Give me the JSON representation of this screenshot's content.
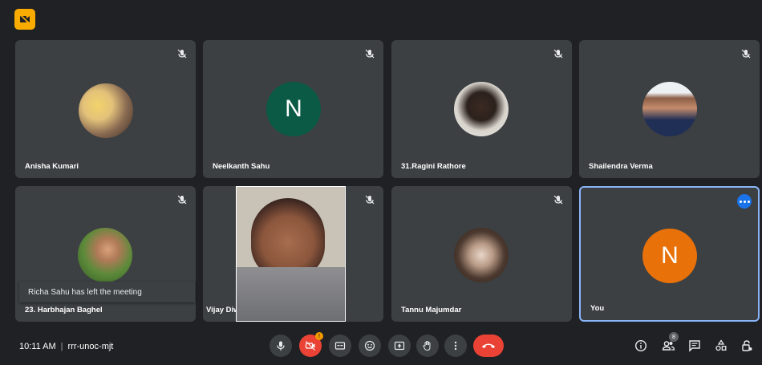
{
  "participants": [
    {
      "name": "Anisha Kumari",
      "avatar": "photo"
    },
    {
      "name": "Neelkanth Sahu",
      "avatar": "letter",
      "initial": "N",
      "color": "#0b5a45"
    },
    {
      "name": "31.Ragini Rathore",
      "avatar": "photo"
    },
    {
      "name": "Shailendra Verma",
      "avatar": "photo"
    },
    {
      "name": "23. Harbhajan Baghel",
      "avatar": "photo"
    },
    {
      "name": "Vijay Diwan",
      "avatar": "video"
    },
    {
      "name": "Tannu Majumdar",
      "avatar": "photo"
    },
    {
      "name": "You",
      "avatar": "letter",
      "initial": "N",
      "color": "#e8710a"
    }
  ],
  "notification": {
    "text": "Richa Sahu has left the meeting"
  },
  "meeting": {
    "time": "10:11 AM",
    "separator": "|",
    "code": "rrr-unoc-mjt"
  },
  "controls": {
    "icons": [
      "mic-icon",
      "camera-off-icon",
      "captions-icon",
      "emoji-icon",
      "present-icon",
      "raise-hand-icon",
      "more-options-icon",
      "end-call-icon"
    ],
    "camera_badge": "!"
  },
  "right_panel": {
    "icons": [
      "info-icon",
      "people-icon",
      "chat-icon",
      "activities-icon",
      "host-controls-icon"
    ],
    "people_count": "8"
  },
  "colors": {
    "background": "#202124",
    "tile": "#3c4043",
    "accent": "#1a73e8",
    "danger": "#ea4335",
    "logo": "#f9ab00"
  }
}
